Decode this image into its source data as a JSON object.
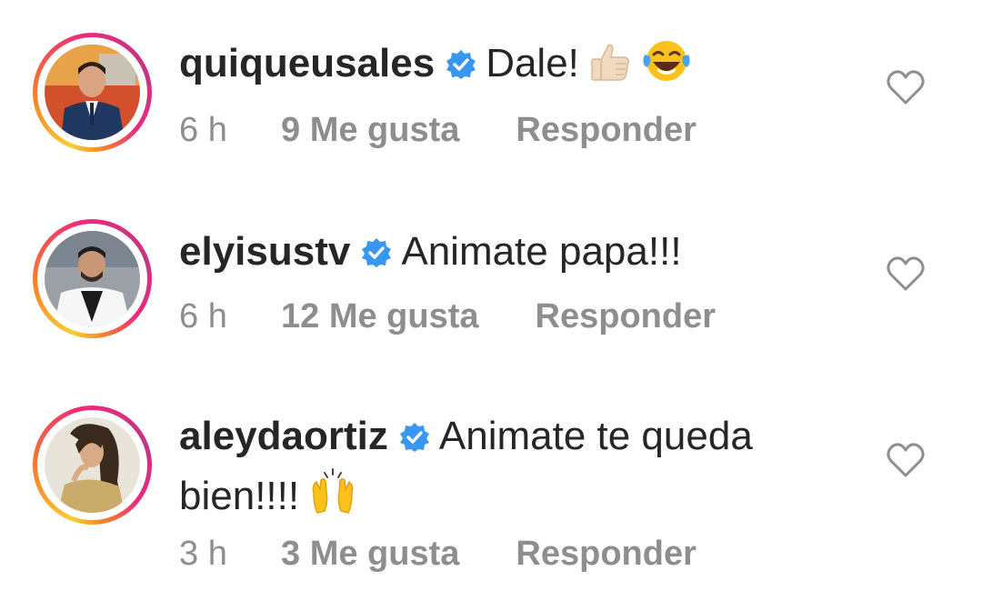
{
  "comments": [
    {
      "username": "quiqueusales",
      "text": "Dale!",
      "time": "6 h",
      "likes": "9 Me gusta",
      "reply": "Responder"
    },
    {
      "username": "elyisustv",
      "text": "Animate papa!!!",
      "time": "6 h",
      "likes": "12 Me gusta",
      "reply": "Responder"
    },
    {
      "username": "aleydaortiz",
      "text": "Animate te queda bien!!!!",
      "time": "3 h",
      "likes": "3 Me gusta",
      "reply": "Responder"
    }
  ],
  "icons": {
    "verified": "verified-badge-icon",
    "like": "heart-outline-icon",
    "thumbs_up": "thumbs-up-emoji",
    "laughing": "tears-of-joy-emoji",
    "raised_hands": "raised-hands-emoji"
  },
  "colors": {
    "text": "#262626",
    "meta": "#8e8e8e",
    "verified": "#3897f0"
  }
}
